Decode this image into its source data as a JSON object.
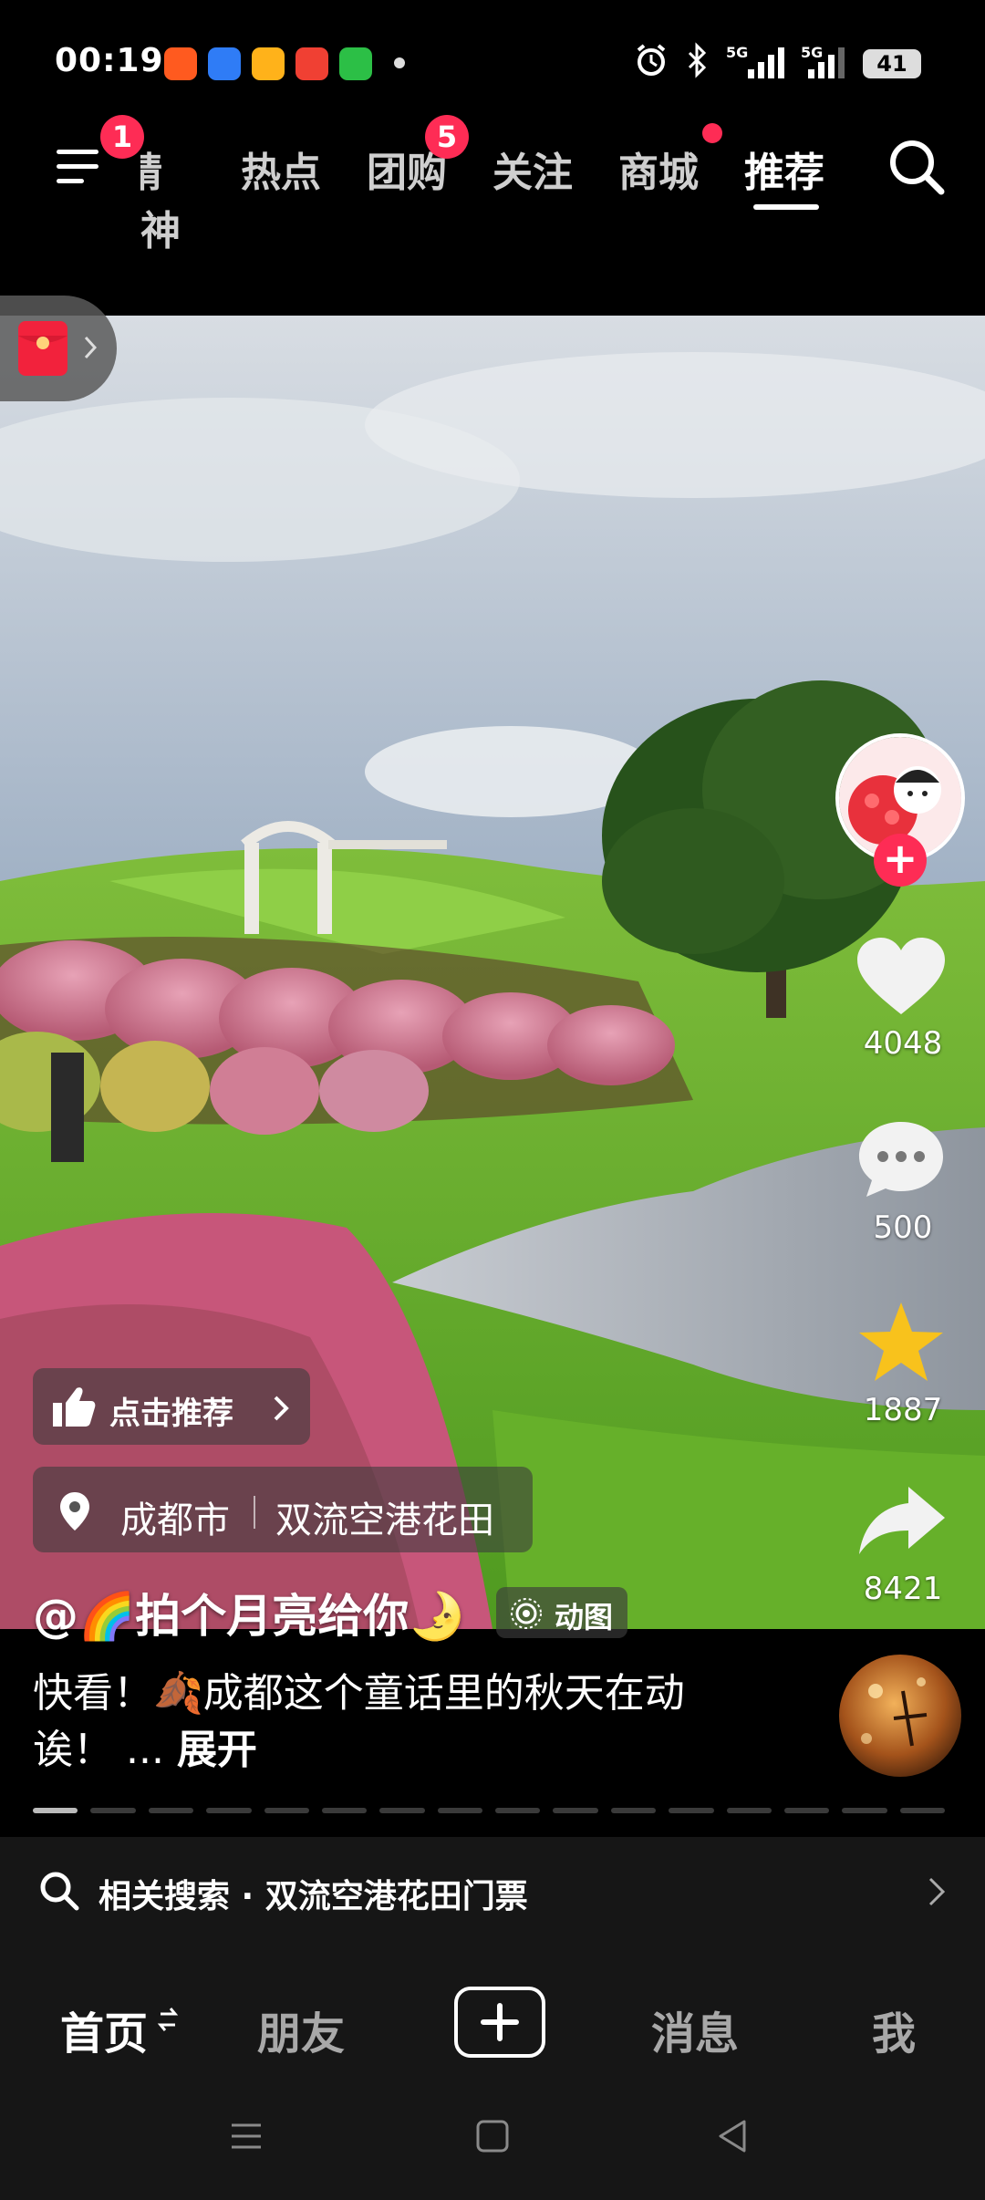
{
  "status_bar": {
    "time": "00:19",
    "network_1": "5G",
    "network_2": "5G",
    "battery": "41"
  },
  "top_nav": {
    "menu_badge": "1",
    "tabs": [
      {
        "label": "精神"
      },
      {
        "label": "热点"
      },
      {
        "label": "团购",
        "badge": "5"
      },
      {
        "label": "关注"
      },
      {
        "label": "商城"
      },
      {
        "label": "推荐",
        "active": true
      }
    ]
  },
  "actions": {
    "likes": "4048",
    "comments": "500",
    "favorites": "1887",
    "shares": "8421"
  },
  "video": {
    "recommend_label": "点击推荐",
    "location_city": "成都市",
    "location_place": "双流空港花田",
    "author": "@🌈拍个月亮给你🌛",
    "live_photo_label": "动图",
    "caption_line1": "快看！🍂成都这个童话里的秋天在动",
    "caption_line2_prefix": "诶！ ... ",
    "caption_expand": "展开"
  },
  "progress": {
    "total_segments": 16,
    "current_segment": 1
  },
  "related_search": {
    "text": "相关搜索 · 双流空港花田门票"
  },
  "bottom_tabs": {
    "home": "首页",
    "friends": "朋友",
    "messages": "消息",
    "me": "我"
  },
  "colors": {
    "accent": "#fe2c55",
    "favorite": "#f8c21c",
    "background": "#000000",
    "bar": "#161616"
  }
}
